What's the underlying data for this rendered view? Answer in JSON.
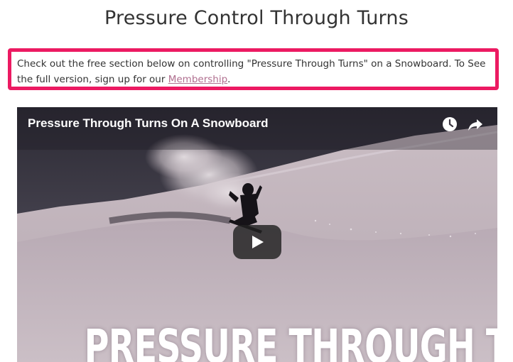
{
  "page": {
    "title": "Pressure Control Through Turns"
  },
  "notice": {
    "text_before": "Check out the free section below on controlling \"Pressure Through Turns\" on a Snowboard. To See the full version, sign up for our ",
    "link_text": "Membership",
    "text_after": ".",
    "border_color": "#ec1a62"
  },
  "video": {
    "title": "Pressure Through Turns On A Snowboard",
    "overlay_text": "PRESSURE THROUGH TURNS",
    "icons": {
      "watch_later": "clock-icon",
      "share": "share-arrow-icon",
      "play": "play-icon"
    }
  }
}
